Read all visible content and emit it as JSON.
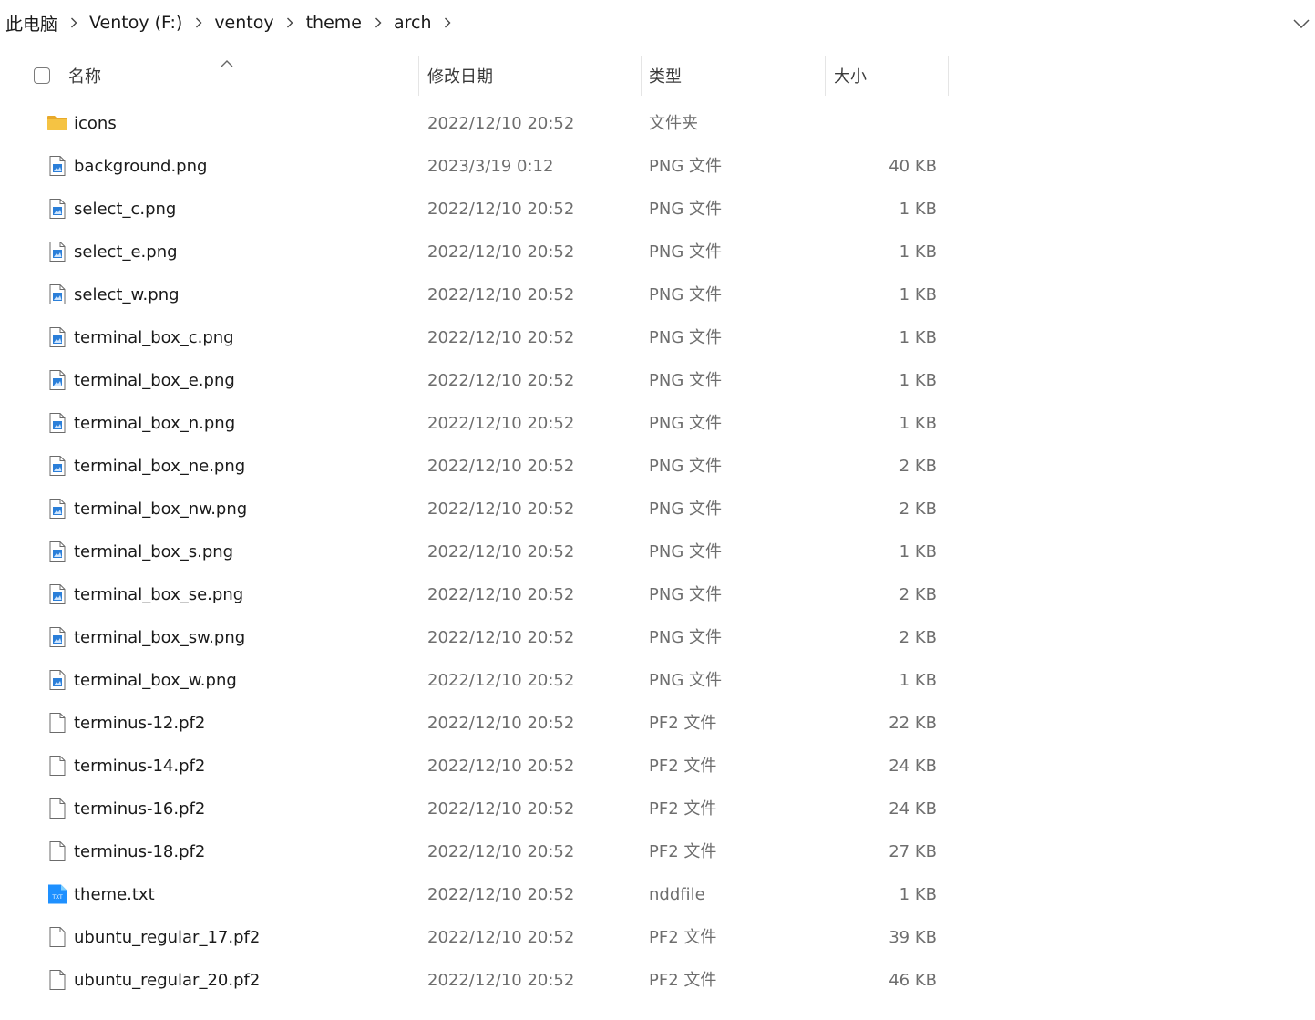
{
  "breadcrumb": {
    "items": [
      "此电脑",
      "Ventoy (F:)",
      "ventoy",
      "theme",
      "arch"
    ]
  },
  "columns": {
    "name": "名称",
    "date": "修改日期",
    "type": "类型",
    "size": "大小"
  },
  "colors": {
    "folder": "#f5c343",
    "png_accent": "#2b7fd9",
    "txt_badge": "#1e90ff"
  },
  "files": [
    {
      "name": "icons",
      "date": "2022/12/10 20:52",
      "type": "文件夹",
      "size": "",
      "icon": "folder-icon"
    },
    {
      "name": "background.png",
      "date": "2023/3/19 0:12",
      "type": "PNG 文件",
      "size": "40 KB",
      "icon": "png-file-icon"
    },
    {
      "name": "select_c.png",
      "date": "2022/12/10 20:52",
      "type": "PNG 文件",
      "size": "1 KB",
      "icon": "png-file-icon"
    },
    {
      "name": "select_e.png",
      "date": "2022/12/10 20:52",
      "type": "PNG 文件",
      "size": "1 KB",
      "icon": "png-file-icon"
    },
    {
      "name": "select_w.png",
      "date": "2022/12/10 20:52",
      "type": "PNG 文件",
      "size": "1 KB",
      "icon": "png-file-icon"
    },
    {
      "name": "terminal_box_c.png",
      "date": "2022/12/10 20:52",
      "type": "PNG 文件",
      "size": "1 KB",
      "icon": "png-file-icon"
    },
    {
      "name": "terminal_box_e.png",
      "date": "2022/12/10 20:52",
      "type": "PNG 文件",
      "size": "1 KB",
      "icon": "png-file-icon"
    },
    {
      "name": "terminal_box_n.png",
      "date": "2022/12/10 20:52",
      "type": "PNG 文件",
      "size": "1 KB",
      "icon": "png-file-icon"
    },
    {
      "name": "terminal_box_ne.png",
      "date": "2022/12/10 20:52",
      "type": "PNG 文件",
      "size": "2 KB",
      "icon": "png-file-icon"
    },
    {
      "name": "terminal_box_nw.png",
      "date": "2022/12/10 20:52",
      "type": "PNG 文件",
      "size": "2 KB",
      "icon": "png-file-icon"
    },
    {
      "name": "terminal_box_s.png",
      "date": "2022/12/10 20:52",
      "type": "PNG 文件",
      "size": "1 KB",
      "icon": "png-file-icon"
    },
    {
      "name": "terminal_box_se.png",
      "date": "2022/12/10 20:52",
      "type": "PNG 文件",
      "size": "2 KB",
      "icon": "png-file-icon"
    },
    {
      "name": "terminal_box_sw.png",
      "date": "2022/12/10 20:52",
      "type": "PNG 文件",
      "size": "2 KB",
      "icon": "png-file-icon"
    },
    {
      "name": "terminal_box_w.png",
      "date": "2022/12/10 20:52",
      "type": "PNG 文件",
      "size": "1 KB",
      "icon": "png-file-icon"
    },
    {
      "name": "terminus-12.pf2",
      "date": "2022/12/10 20:52",
      "type": "PF2 文件",
      "size": "22 KB",
      "icon": "blank-file-icon"
    },
    {
      "name": "terminus-14.pf2",
      "date": "2022/12/10 20:52",
      "type": "PF2 文件",
      "size": "24 KB",
      "icon": "blank-file-icon"
    },
    {
      "name": "terminus-16.pf2",
      "date": "2022/12/10 20:52",
      "type": "PF2 文件",
      "size": "24 KB",
      "icon": "blank-file-icon"
    },
    {
      "name": "terminus-18.pf2",
      "date": "2022/12/10 20:52",
      "type": "PF2 文件",
      "size": "27 KB",
      "icon": "blank-file-icon"
    },
    {
      "name": "theme.txt",
      "date": "2022/12/10 20:52",
      "type": "nddfile",
      "size": "1 KB",
      "icon": "txt-file-icon"
    },
    {
      "name": "ubuntu_regular_17.pf2",
      "date": "2022/12/10 20:52",
      "type": "PF2 文件",
      "size": "39 KB",
      "icon": "blank-file-icon"
    },
    {
      "name": "ubuntu_regular_20.pf2",
      "date": "2022/12/10 20:52",
      "type": "PF2 文件",
      "size": "46 KB",
      "icon": "blank-file-icon"
    }
  ]
}
